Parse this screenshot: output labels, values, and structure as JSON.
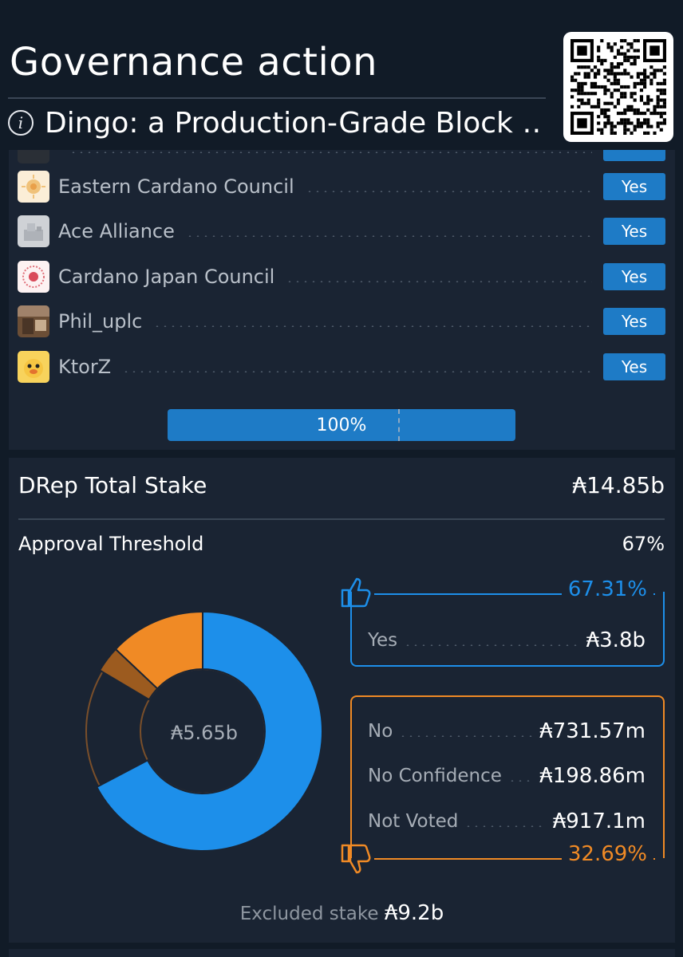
{
  "header": {
    "title": "Governance action",
    "subtitle": "Dingo: a Production-Grade Block …",
    "info_icon_glyph": "i",
    "info_icon": "info-circle-icon",
    "qr_icon": "qr-code-icon"
  },
  "voters": [
    {
      "name": "",
      "vote": "",
      "avatar_color": "#2a2f36"
    },
    {
      "name": "Eastern Cardano Council",
      "vote": "Yes",
      "avatar_color": "#f3d9a6"
    },
    {
      "name": "Ace Alliance",
      "vote": "Yes",
      "avatar_color": "#c9ccd0"
    },
    {
      "name": "Cardano Japan Council",
      "vote": "Yes",
      "avatar_color": "#f7dede"
    },
    {
      "name": "Phil_uplc",
      "vote": "Yes",
      "avatar_color": "#8a6a4a"
    },
    {
      "name": "KtorZ",
      "vote": "Yes",
      "avatar_color": "#f6c542"
    }
  ],
  "progress": {
    "label": "100%",
    "value": 1.0
  },
  "drep": {
    "title": "DRep Total Stake",
    "total": "₳14.85b",
    "threshold_label": "Approval Threshold",
    "threshold_value": "67%",
    "center_label": "₳5.65b",
    "yes": {
      "percent": "67.31%",
      "rows": [
        {
          "label": "Yes",
          "value": "₳3.8b"
        }
      ]
    },
    "no": {
      "percent": "32.69%",
      "rows": [
        {
          "label": "No",
          "value": "₳731.57m"
        },
        {
          "label": "No Confidence",
          "value": "₳198.86m"
        },
        {
          "label": "Not Voted",
          "value": "₳917.1m"
        }
      ]
    },
    "excluded_label": "Excluded stake",
    "excluded_value": "₳9.2b",
    "colors": {
      "yes": "#1d8fea",
      "no": "#f08a25",
      "no_confidence": "#9c5b1f",
      "not_voted": "#8a5a2a"
    },
    "thumbs_up_icon": "thumbs-up-icon",
    "thumbs_down_icon": "thumbs-down-icon"
  },
  "chart_data": {
    "type": "pie",
    "center_label": "₳5.65b",
    "series": [
      {
        "name": "Yes",
        "value": 3.8
      },
      {
        "name": "Not Voted",
        "value": 0.9171
      },
      {
        "name": "No Confidence",
        "value": 0.19886
      },
      {
        "name": "No",
        "value": 0.73157
      }
    ]
  }
}
